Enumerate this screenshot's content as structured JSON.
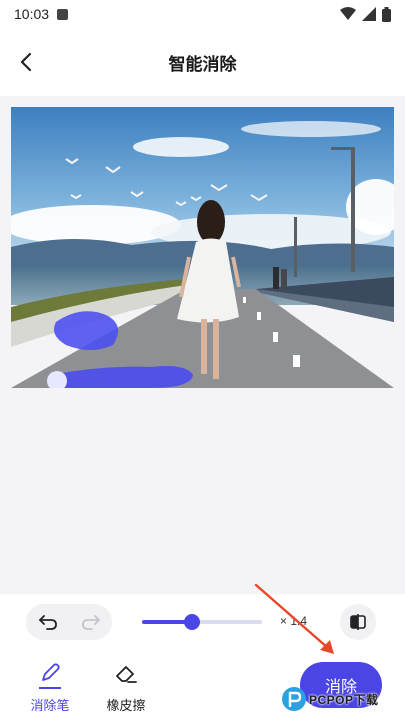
{
  "status_bar": {
    "time": "10:03",
    "icons": [
      "app-notification-icon",
      "wifi-icon",
      "signal-icon",
      "battery-icon"
    ]
  },
  "header": {
    "title": "智能消除",
    "back_icon": "chevron-left-icon"
  },
  "photo": {
    "description_icon": "edited-photo",
    "has_brush_marks": true
  },
  "toolbar": {
    "undo_icon": "undo-icon",
    "redo_icon": "redo-icon",
    "brush_size_fraction": 0.42,
    "zoom_text": "× 1.4",
    "compare_icon": "compare-icon"
  },
  "bottom_bar": {
    "tabs": [
      {
        "label": "消除笔",
        "icon": "brush-pen-icon",
        "active": true
      },
      {
        "label": "橡皮擦",
        "icon": "eraser-icon",
        "active": false
      }
    ],
    "remove_button_label": "消除"
  },
  "watermark": {
    "text": "PCPOP下载"
  },
  "colors": {
    "accent": "#4b45e6",
    "canvas_bg": "#f4f4f6",
    "arrow": "#e8482a"
  }
}
